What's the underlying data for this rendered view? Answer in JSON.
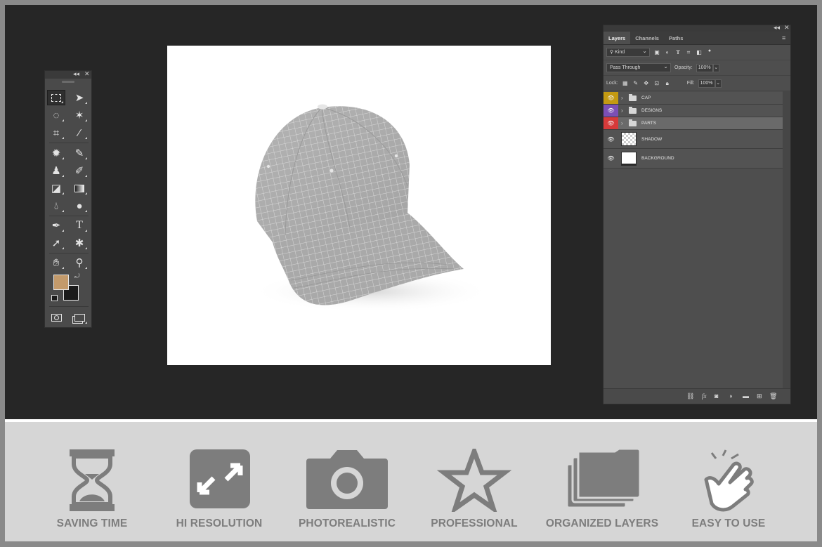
{
  "layers_panel": {
    "tabs": [
      "Layers",
      "Channels",
      "Paths"
    ],
    "filter": {
      "kind_label": "Kind"
    },
    "blend_mode": "Pass Through",
    "opacity_label": "Opacity:",
    "opacity_value": "100%",
    "lock_label": "Lock:",
    "fill_label": "Fill:",
    "fill_value": "100%",
    "layers": [
      {
        "name": "CAP",
        "type": "group",
        "tag_color": "#c49a12"
      },
      {
        "name": "DESIGNS",
        "type": "group",
        "tag_color": "#7b4fb5"
      },
      {
        "name": "PARTS",
        "type": "group",
        "tag_color": "#d63a3a"
      },
      {
        "name": "SHADOW",
        "type": "layer"
      },
      {
        "name": "BACKGROUND",
        "type": "layer"
      }
    ]
  },
  "toolbox": {
    "foreground_color": "#c39a6b",
    "background_color": "#1b1b1b",
    "tools": [
      "marquee-icon",
      "move-icon",
      "lasso-icon",
      "magic-wand-icon",
      "crop-icon",
      "eyedropper-icon",
      "healing-icon",
      "brush-icon",
      "stamp-icon",
      "history-brush-icon",
      "eraser-icon",
      "gradient-icon",
      "blur-icon",
      "dodge-icon",
      "pen-icon",
      "type-icon",
      "path-select-icon",
      "shape-icon",
      "hand-icon",
      "zoom-icon"
    ]
  },
  "features": [
    {
      "label": "SAVING TIME",
      "icon": "hourglass-icon"
    },
    {
      "label": "HI RESOLUTION",
      "icon": "expand-arrows-icon"
    },
    {
      "label": "PHOTOREALISTIC",
      "icon": "camera-icon"
    },
    {
      "label": "PROFESSIONAL",
      "icon": "star-icon"
    },
    {
      "label": "ORGANIZED LAYERS",
      "icon": "stacked-folders-icon"
    },
    {
      "label": "EASY TO USE",
      "icon": "tap-hand-icon"
    }
  ]
}
